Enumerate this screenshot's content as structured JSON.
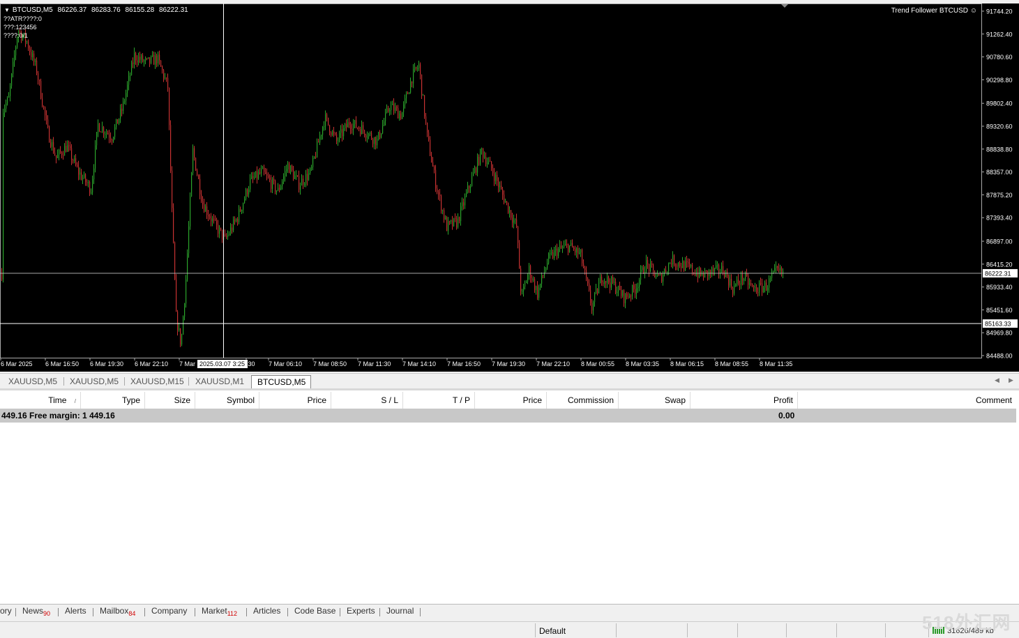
{
  "chart": {
    "symbol_period": "BTCUSD,M5",
    "ohlc": [
      "86226.37",
      "86283.76",
      "86155.28",
      "86222.31"
    ],
    "indicator_lines": [
      "??ATR????:0",
      "???:123456",
      "????:0/1"
    ],
    "ea_name": "Trend Follower BTCUSD",
    "price_axis": [
      "91744.20",
      "91262.40",
      "90780.60",
      "90298.80",
      "89802.40",
      "89320.60",
      "88838.80",
      "88357.00",
      "87875.20",
      "87393.40",
      "86897.00",
      "86415.20",
      "85933.40",
      "85451.60",
      "84969.80",
      "84488.00"
    ],
    "bid_label": "86222.31",
    "crosshair_price_label": "85163.33",
    "crosshair_time_label": "2025.03.07 3:25",
    "time_axis": [
      "6 Mar 2025",
      "6 Mar 16:50",
      "6 Mar 19:30",
      "6 Mar 22:10",
      "7 Mar",
      ":30",
      "7 Mar 06:10",
      "7 Mar 08:50",
      "7 Mar 11:30",
      "7 Mar 14:10",
      "7 Mar 16:50",
      "7 Mar 19:30",
      "7 Mar 22:10",
      "8 Mar 00:55",
      "8 Mar 03:35",
      "8 Mar 06:15",
      "8 Mar 08:55",
      "8 Mar 11:35"
    ],
    "colors": {
      "background": "#000000",
      "bull": "#2ca52c",
      "bear": "#c83232",
      "crosshair": "#ffffff",
      "bid_line": "#c0c0c0"
    }
  },
  "chart_tabs": [
    "XAUUSD,M5",
    "XAUUSD,M5",
    "XAUUSD,M15",
    "XAUUSD,M1",
    "BTCUSD,M5"
  ],
  "active_chart_tab": "BTCUSD,M5",
  "terminal": {
    "columns": [
      "Time",
      "Type",
      "Size",
      "Symbol",
      "Price",
      "S / L",
      "T / P",
      "Price",
      "Commission",
      "Swap",
      "Profit",
      "Comment"
    ],
    "sort_indicator": "/",
    "summary_left": "449.16  Free margin: 1 449.16",
    "summary_profit": "0.00"
  },
  "bottom_tabs": [
    {
      "label": "ory",
      "badge": ""
    },
    {
      "label": "News",
      "badge": "90"
    },
    {
      "label": "Alerts",
      "badge": ""
    },
    {
      "label": "Mailbox",
      "badge": "84"
    },
    {
      "label": "Company",
      "badge": ""
    },
    {
      "label": "Market",
      "badge": "112"
    },
    {
      "label": "Articles",
      "badge": ""
    },
    {
      "label": "Code Base",
      "badge": ""
    },
    {
      "label": "Experts",
      "badge": ""
    },
    {
      "label": "Journal",
      "badge": ""
    }
  ],
  "status": {
    "profile": "Default",
    "traffic": "31626/489 kb"
  },
  "watermark": "518外汇网"
}
